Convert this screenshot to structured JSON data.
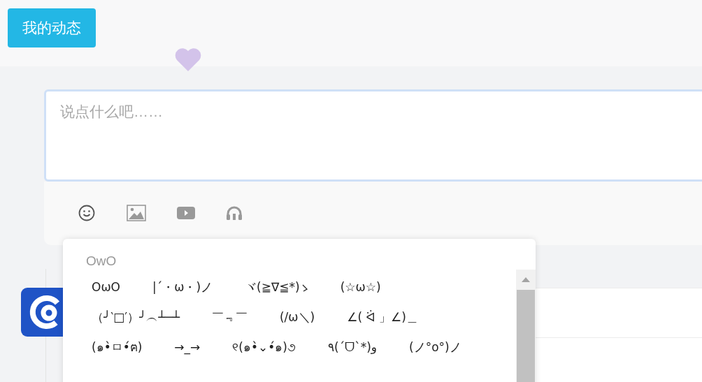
{
  "header": {
    "button": "我的动态"
  },
  "composer": {
    "placeholder": "说点什么吧……"
  },
  "toolbar": [
    {
      "kind": "emoji"
    },
    {
      "kind": "image"
    },
    {
      "kind": "video"
    },
    {
      "kind": "music"
    }
  ],
  "emoji_panel": {
    "title": "OwO",
    "rows": [
      [
        "OωO",
        "|´・ω・)ノ",
        {
          "text": "ヾ(≧∇≦*)",
          "kind": "trailing_mark"
        },
        "(☆ω☆)"
      ],
      [
        "（╯‵□′）╯︵┴─┴",
        "￣﹃￣",
        "(/ω＼)",
        "∠( ᐛ 」∠)＿"
      ],
      [
        "(๑•̀ㅁ•́ฅ)",
        "→_→",
        "୧(๑•̀⌄•́๑)૭",
        "٩(ˊᗜˋ*)و",
        "(ノ°ο°)ノ"
      ]
    ]
  }
}
